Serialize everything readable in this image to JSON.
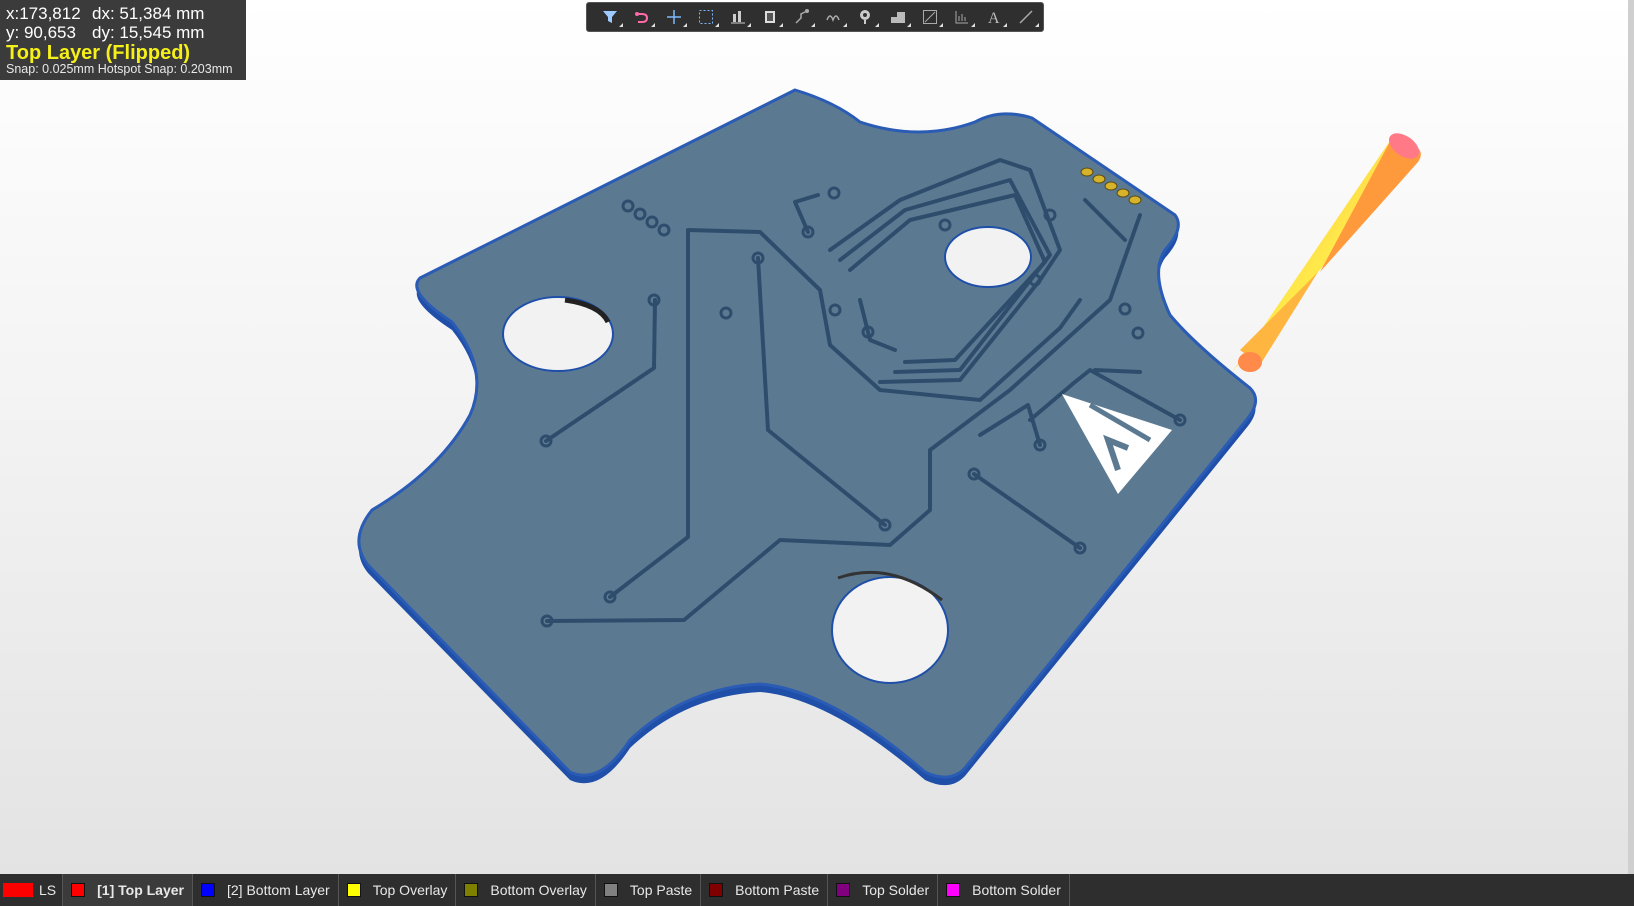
{
  "hud": {
    "x": "x:173,812",
    "dx": "dx: 51,384 mm",
    "y": "y: 90,653",
    "dy": "dy: 15,545 mm",
    "layer": "Top Layer (Flipped)",
    "snap": "Snap: 0.025mm Hotspot Snap: 0.203mm"
  },
  "toolbar": {
    "icons": [
      "filter-icon",
      "interactive-routing-icon",
      "crosshair-icon",
      "select-rectangle-icon",
      "align-icon",
      "component-icon",
      "route-icon",
      "diff-pair-icon",
      "pad-icon",
      "polygon-icon",
      "dimension-icon",
      "chart-icon",
      "text-icon",
      "line-icon"
    ]
  },
  "layer_bar": {
    "ls_label": "LS",
    "ls_color": "#ff0000",
    "tabs": [
      {
        "label": "[1] Top Layer",
        "color": "#ff0000",
        "active": true
      },
      {
        "label": "[2] Bottom Layer",
        "color": "#0000ff",
        "active": false
      },
      {
        "label": "Top Overlay",
        "color": "#ffff00",
        "active": false
      },
      {
        "label": "Bottom Overlay",
        "color": "#808000",
        "active": false
      },
      {
        "label": "Top Paste",
        "color": "#808080",
        "active": false
      },
      {
        "label": "Bottom Paste",
        "color": "#800000",
        "active": false
      },
      {
        "label": "Top Solder",
        "color": "#800080",
        "active": false
      },
      {
        "label": "Bottom Solder",
        "color": "#ff00ff",
        "active": false
      }
    ]
  },
  "colors": {
    "board": "#5b7a92",
    "board_edge": "#1f4fa8",
    "trace": "#2e4d6d",
    "pad": "#d6b32a",
    "silkscreen": "#ffffff"
  }
}
